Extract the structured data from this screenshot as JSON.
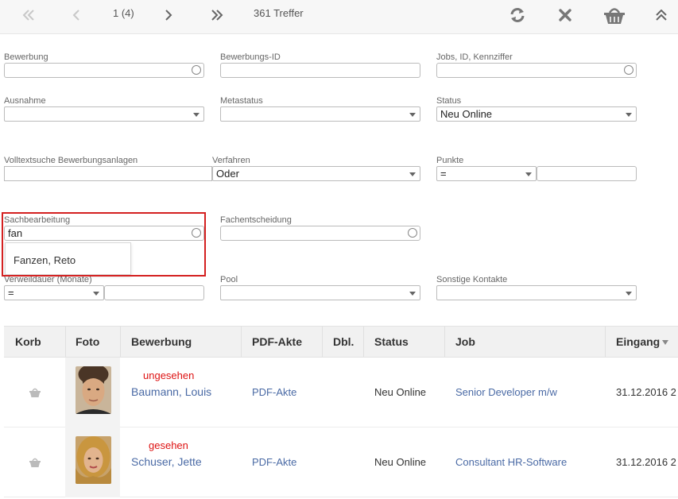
{
  "toolbar": {
    "page_info": "1 (4)",
    "hits": "361 Treffer",
    "icons": [
      "first-page-icon",
      "prev-page-icon",
      "next-page-icon",
      "last-page-icon",
      "refresh-icon",
      "close-icon",
      "basket-icon",
      "collapse-icon"
    ]
  },
  "form": {
    "bewerbung": {
      "label": "Bewerbung",
      "value": ""
    },
    "bewerbungs_id": {
      "label": "Bewerbungs-ID",
      "value": ""
    },
    "jobs": {
      "label": "Jobs, ID, Kennziffer",
      "value": ""
    },
    "ausnahme": {
      "label": "Ausnahme",
      "value": ""
    },
    "metastatus": {
      "label": "Metastatus",
      "value": ""
    },
    "status": {
      "label": "Status",
      "value": "Neu Online"
    },
    "volltext": {
      "label": "Volltextsuche Bewerbungsanlagen",
      "value": ""
    },
    "verfahren": {
      "label": "Verfahren",
      "value": "Oder"
    },
    "punkte": {
      "label": "Punkte",
      "op": "=",
      "value": ""
    },
    "sachbearbeitung": {
      "label": "Sachbearbeitung",
      "value": "fan",
      "suggestion": "Fanzen, Reto"
    },
    "fachentscheidung": {
      "label": "Fachentscheidung",
      "value": ""
    },
    "verweildauer": {
      "label": "Verweildauer (Monate)",
      "op": "=",
      "value": ""
    },
    "pool": {
      "label": "Pool",
      "value": ""
    },
    "sonstige": {
      "label": "Sonstige Kontakte",
      "value": ""
    }
  },
  "table": {
    "headers": {
      "korb": "Korb",
      "foto": "Foto",
      "bewerbung": "Bewerbung",
      "pdf": "PDF-Akte",
      "dbl": "Dbl.",
      "status": "Status",
      "job": "Job",
      "eingang": "Eingang"
    },
    "rows": [
      {
        "seen": "ungesehen",
        "name": "Baumann, Louis",
        "pdf": "PDF-Akte",
        "dbl": "",
        "status": "Neu Online",
        "job": "Senior Developer m/w",
        "eingang": "31.12.2016 2"
      },
      {
        "seen": "gesehen",
        "name": "Schuser, Jette",
        "pdf": "PDF-Akte",
        "dbl": "",
        "status": "Neu Online",
        "job": "Consultant HR-Software",
        "eingang": "31.12.2016 2"
      }
    ]
  },
  "colors": {
    "accent_link": "#4a6aa5",
    "seen_status": "#dd1111",
    "highlight_border": "#d42020"
  }
}
